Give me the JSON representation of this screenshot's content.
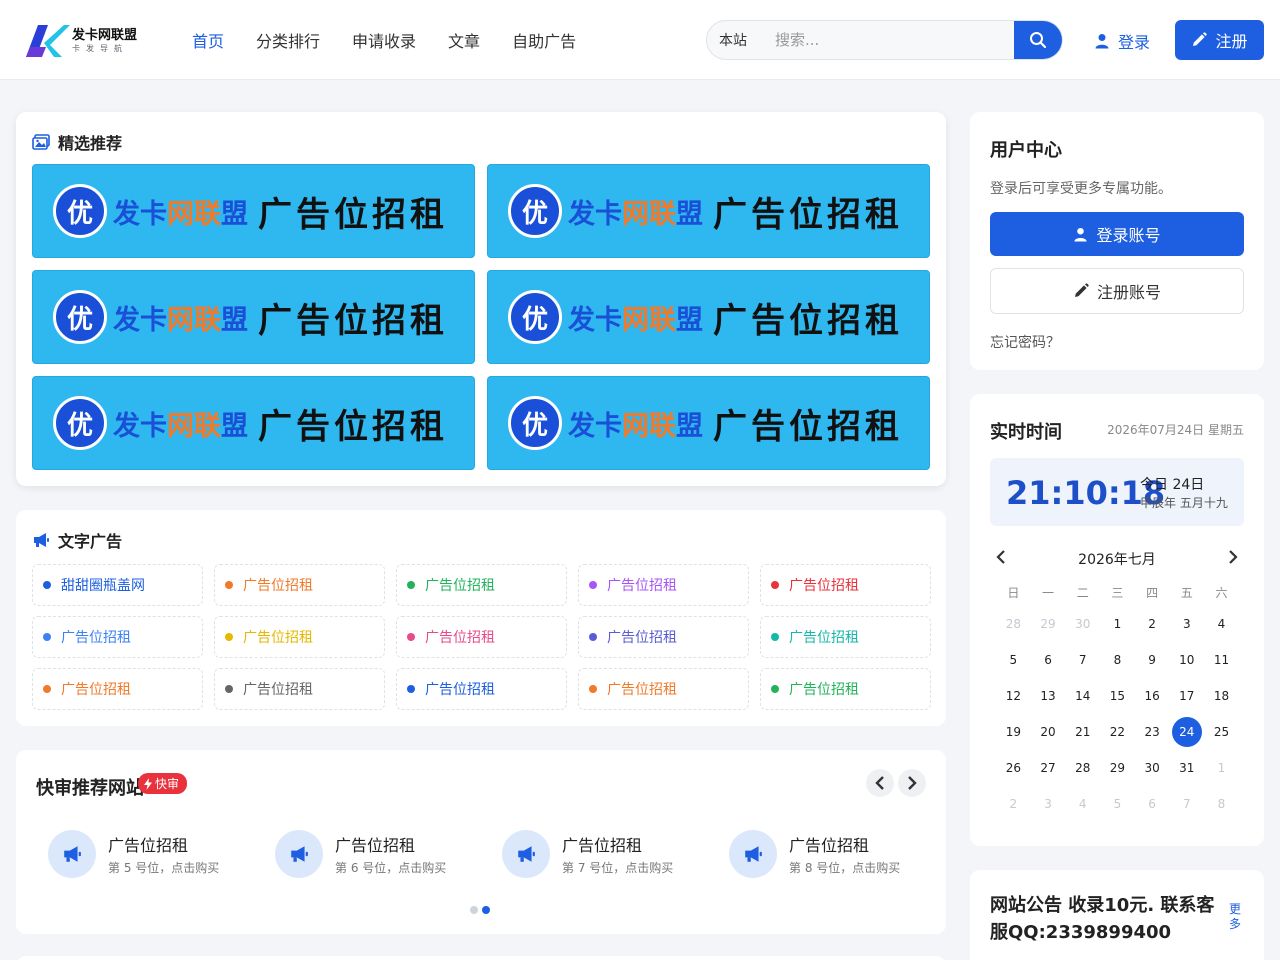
{
  "header": {
    "logo": {
      "title": "发卡网联盟",
      "subtitle": "卡发导航"
    },
    "nav": [
      "首页",
      "分类排行",
      "申请收录",
      "文章",
      "自助广告"
    ],
    "search": {
      "scope": "本站",
      "placeholder": "搜索..."
    },
    "login_label": "登录",
    "register_label": "注册"
  },
  "featured": {
    "title": "精选推荐",
    "banner": {
      "circle": "优",
      "brand_1": "发卡",
      "brand_2": "网联",
      "brand_3": "盟",
      "slogan": "广告位招租"
    },
    "banner_count": 6
  },
  "text_ads": {
    "title": "文字广告",
    "items": [
      {
        "label": "甜甜圈瓶盖网",
        "color": "#1d5fe0"
      },
      {
        "label": "广告位招租",
        "color": "#f07a2a"
      },
      {
        "label": "广告位招租",
        "color": "#22b35a"
      },
      {
        "label": "广告位招租",
        "color": "#a855f7"
      },
      {
        "label": "广告位招租",
        "color": "#e8323c"
      },
      {
        "label": "广告位招租",
        "color": "#3b82f6"
      },
      {
        "label": "广告位招租",
        "color": "#e6b800"
      },
      {
        "label": "广告位招租",
        "color": "#e84a8a"
      },
      {
        "label": "广告位招租",
        "color": "#5b5bd6"
      },
      {
        "label": "广告位招租",
        "color": "#14b8a6"
      },
      {
        "label": "广告位招租",
        "color": "#f07a2a"
      },
      {
        "label": "广告位招租",
        "color": "#666666"
      },
      {
        "label": "广告位招租",
        "color": "#1d5fe0"
      },
      {
        "label": "广告位招租",
        "color": "#f07a2a"
      },
      {
        "label": "广告位招租",
        "color": "#22b35a"
      }
    ]
  },
  "quick_review": {
    "title": "快审推荐网站",
    "badge": "快审",
    "sites": [
      {
        "name": "广告位招租",
        "desc": "第 5 号位，点击购买"
      },
      {
        "name": "广告位招租",
        "desc": "第 6 号位，点击购买"
      },
      {
        "name": "广告位招租",
        "desc": "第 7 号位，点击购买"
      },
      {
        "name": "广告位招租",
        "desc": "第 8 号位，点击购买"
      }
    ],
    "page_count": 2,
    "active_page": 2
  },
  "user_center": {
    "title": "用户中心",
    "desc": "登录后可享受更多专属功能。",
    "login_button": "登录账号",
    "register_button": "注册账号",
    "forgot": "忘记密码？"
  },
  "realtime": {
    "title": "实时时间",
    "date": "2026年07月24日 星期五",
    "clock": "21:10:18",
    "today": "今日 24日",
    "lunar": "甲辰年 五月十九",
    "calendar": {
      "month_label": "2026年七月",
      "weekdays": [
        "日",
        "一",
        "二",
        "三",
        "四",
        "五",
        "六"
      ],
      "days": [
        [
          "28",
          "29",
          "30",
          "1",
          "2",
          "3",
          "4"
        ],
        [
          "5",
          "6",
          "7",
          "8",
          "9",
          "10",
          "11"
        ],
        [
          "12",
          "13",
          "14",
          "15",
          "16",
          "17",
          "18"
        ],
        [
          "19",
          "20",
          "21",
          "22",
          "23",
          "24",
          "25"
        ],
        [
          "26",
          "27",
          "28",
          "29",
          "30",
          "31",
          "1"
        ],
        [
          "2",
          "3",
          "4",
          "5",
          "6",
          "7",
          "8"
        ]
      ],
      "today": "24"
    }
  },
  "notice": {
    "title": "网站公告 收录10元. 联系客服QQ:2339899400",
    "more": "更多"
  }
}
